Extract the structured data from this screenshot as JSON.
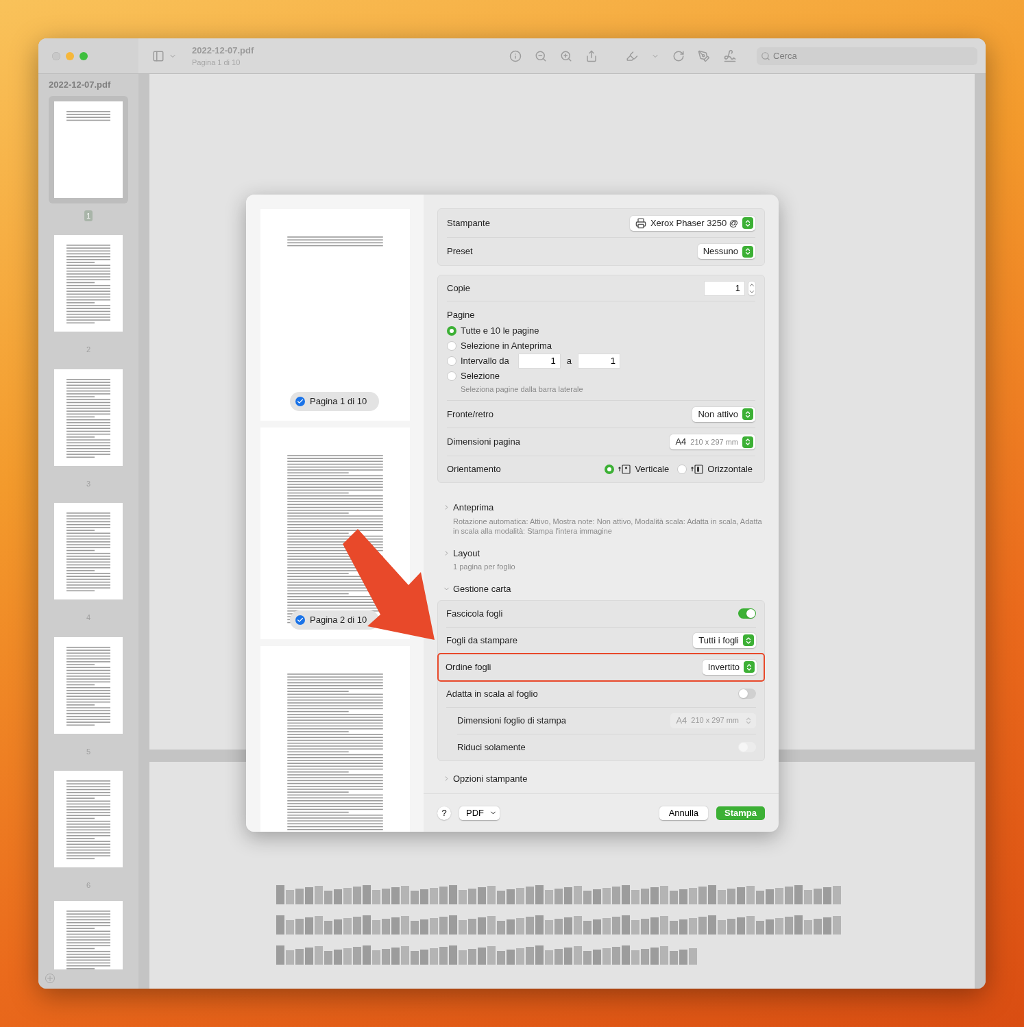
{
  "window": {
    "sidebar_title": "2022-12-07.pdf",
    "document_title": "2022-12-07.pdf",
    "subtitle": "Pagina 1 di 10",
    "search": {
      "placeholder": "Cerca"
    }
  },
  "sidebar": {
    "pages": [
      {
        "label": "1",
        "selected": true
      },
      {
        "label": "2",
        "selected": false
      },
      {
        "label": "3",
        "selected": false
      },
      {
        "label": "4",
        "selected": false
      },
      {
        "label": "5",
        "selected": false
      },
      {
        "label": "6",
        "selected": false
      }
    ]
  },
  "print_dialog": {
    "previews": [
      {
        "label": "Pagina 1 di 10",
        "checked": true
      },
      {
        "label": "Pagina 2 di 10",
        "checked": true
      }
    ],
    "printer": {
      "label": "Stampante",
      "value": "Xerox Phaser 3250 @"
    },
    "preset": {
      "label": "Preset",
      "value": "Nessuno"
    },
    "copies": {
      "label": "Copie",
      "value": "1"
    },
    "pages": {
      "label": "Pagine",
      "options": [
        {
          "kind": "plain",
          "label": "Tutte e 10 le pagine",
          "selected": true
        },
        {
          "kind": "plain",
          "label": "Selezione in Anteprima",
          "selected": false
        },
        {
          "kind": "range",
          "label": "Intervallo da",
          "selected": false,
          "from": "1",
          "to_label": "a",
          "to": "1"
        },
        {
          "kind": "hint",
          "label": "Selezione",
          "selected": false,
          "hint": "Seleziona pagine dalla barra laterale"
        }
      ]
    },
    "duplex": {
      "label": "Fronte/retro",
      "value": "Non attivo"
    },
    "page_size": {
      "label": "Dimensioni pagina",
      "value": "A4",
      "detail": "210 x 297 mm"
    },
    "orientation": {
      "label": "Orientamento",
      "options": [
        {
          "kind": "portrait",
          "label": "Verticale",
          "selected": true
        },
        {
          "kind": "landscape",
          "label": "Orizzontale",
          "selected": false
        }
      ]
    },
    "sections": [
      {
        "title": "Anteprima",
        "expanded": false,
        "summary": "Rotazione automatica: Attivo, Mostra note: Non attivo, Modalità scala: Adatta in scala, Adatta in scala alla modalità: Stampa l'intera immagine"
      },
      {
        "title": "Layout",
        "expanded": false,
        "summary": "1 pagina per foglio"
      },
      {
        "title": "Gestione carta",
        "expanded": true,
        "rows": [
          {
            "kind": "toggle",
            "label": "Fascicola fogli",
            "on": true,
            "disabled": false,
            "indented": false,
            "highlighted": false
          },
          {
            "kind": "popup",
            "label": "Fogli da stampare",
            "value": "Tutti i fogli",
            "disabled": false,
            "indented": false,
            "highlighted": false
          },
          {
            "kind": "popup",
            "label": "Ordine fogli",
            "value": "Invertito",
            "disabled": false,
            "indented": false,
            "highlighted": true
          },
          {
            "kind": "toggle",
            "label": "Adatta in scala al foglio",
            "on": false,
            "disabled": false,
            "indented": false,
            "highlighted": false
          },
          {
            "kind": "popup",
            "label": "Dimensioni foglio di stampa",
            "value": "A4",
            "detail": "210 x 297 mm",
            "disabled": true,
            "indented": true,
            "highlighted": false
          },
          {
            "kind": "toggle",
            "label": "Riduci solamente",
            "on": false,
            "disabled": true,
            "indented": true,
            "highlighted": false
          }
        ]
      },
      {
        "title": "Opzioni stampante",
        "expanded": false
      }
    ],
    "footer": {
      "help": "?",
      "pdf": "PDF",
      "cancel": "Annulla",
      "print": "Stampa"
    }
  }
}
